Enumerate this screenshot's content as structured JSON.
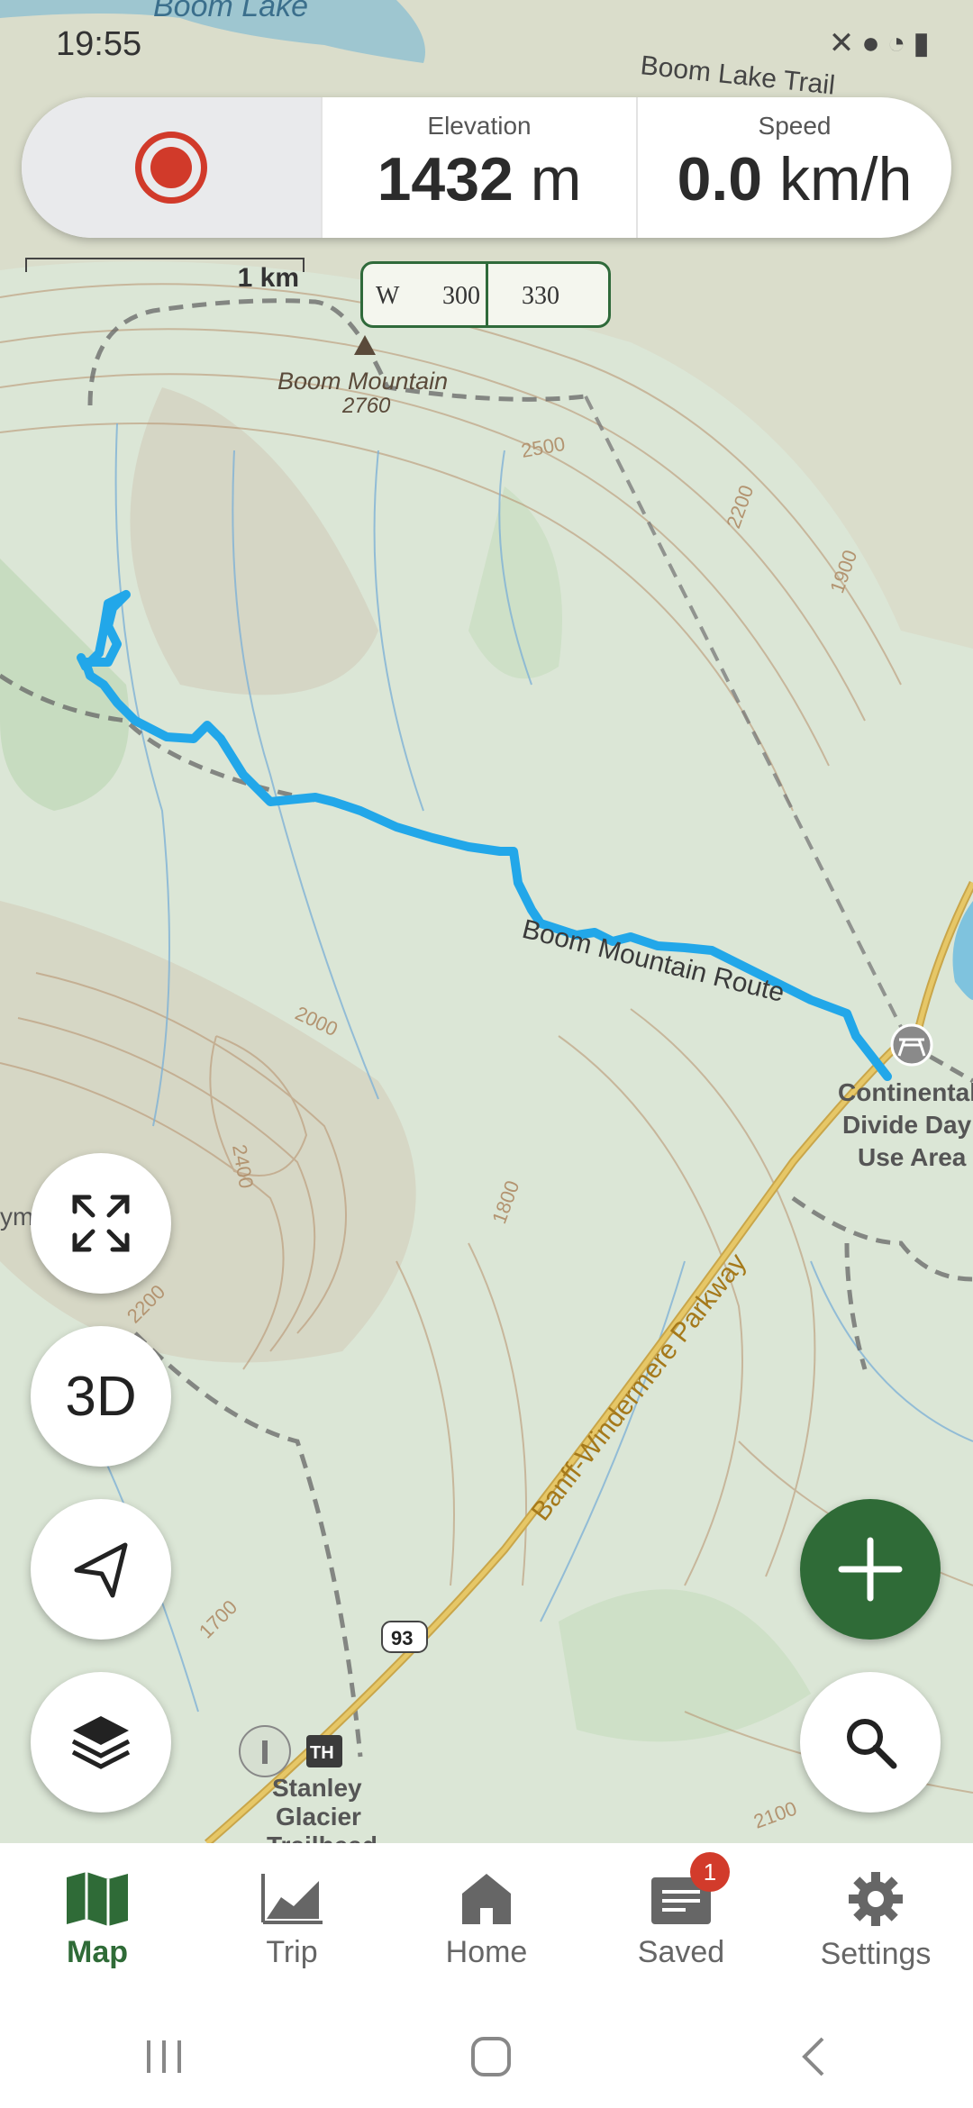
{
  "status_bar": {
    "time": "19:55"
  },
  "stats": {
    "elevation_label": "Elevation",
    "elevation_value": "1432",
    "elevation_unit": "m",
    "speed_label": "Speed",
    "speed_value": "0.0",
    "speed_unit": "km/h"
  },
  "scale_bar": "1 km",
  "compass": {
    "w": "W",
    "a": "300",
    "b": "330"
  },
  "map_labels": {
    "boom_lake": "Boom Lake",
    "boom_lake_trail": "Boom Lake Trail",
    "boom_mountain": "Boom Mountain",
    "boom_mountain_elev": "2760",
    "route": "Boom Mountain Route",
    "day_use_1": "Continental",
    "day_use_2": "Divide Day",
    "day_use_3": "Use Area",
    "parkway": "Banff-Windermere Parkway",
    "highway": "93",
    "trailhead_icon": "TH",
    "trailhead_1": "Stanley",
    "trailhead_2": "Glacier",
    "trailhead_3": "Trailhead",
    "c2500": "2500",
    "c2200": "2200",
    "c1900": "1900",
    "c2000": "2000",
    "c2400": "2400",
    "c1800": "1800",
    "c2200b": "2200",
    "c1700": "1700",
    "c2100": "2100",
    "cut_label": "ym"
  },
  "fab": {
    "three_d": "3D"
  },
  "nav": {
    "map": "Map",
    "trip": "Trip",
    "home": "Home",
    "saved": "Saved",
    "saved_badge": "1",
    "settings": "Settings"
  },
  "colors": {
    "accent": "#2f6b37",
    "track": "#21a8e8",
    "record": "#d13a2a",
    "badge": "#d23b2b"
  },
  "icons": [
    "expand-icon",
    "navigate-icon",
    "layers-icon",
    "plus-icon",
    "search-icon",
    "map-icon",
    "chart-icon",
    "home-icon",
    "saved-icon",
    "gear-icon"
  ]
}
